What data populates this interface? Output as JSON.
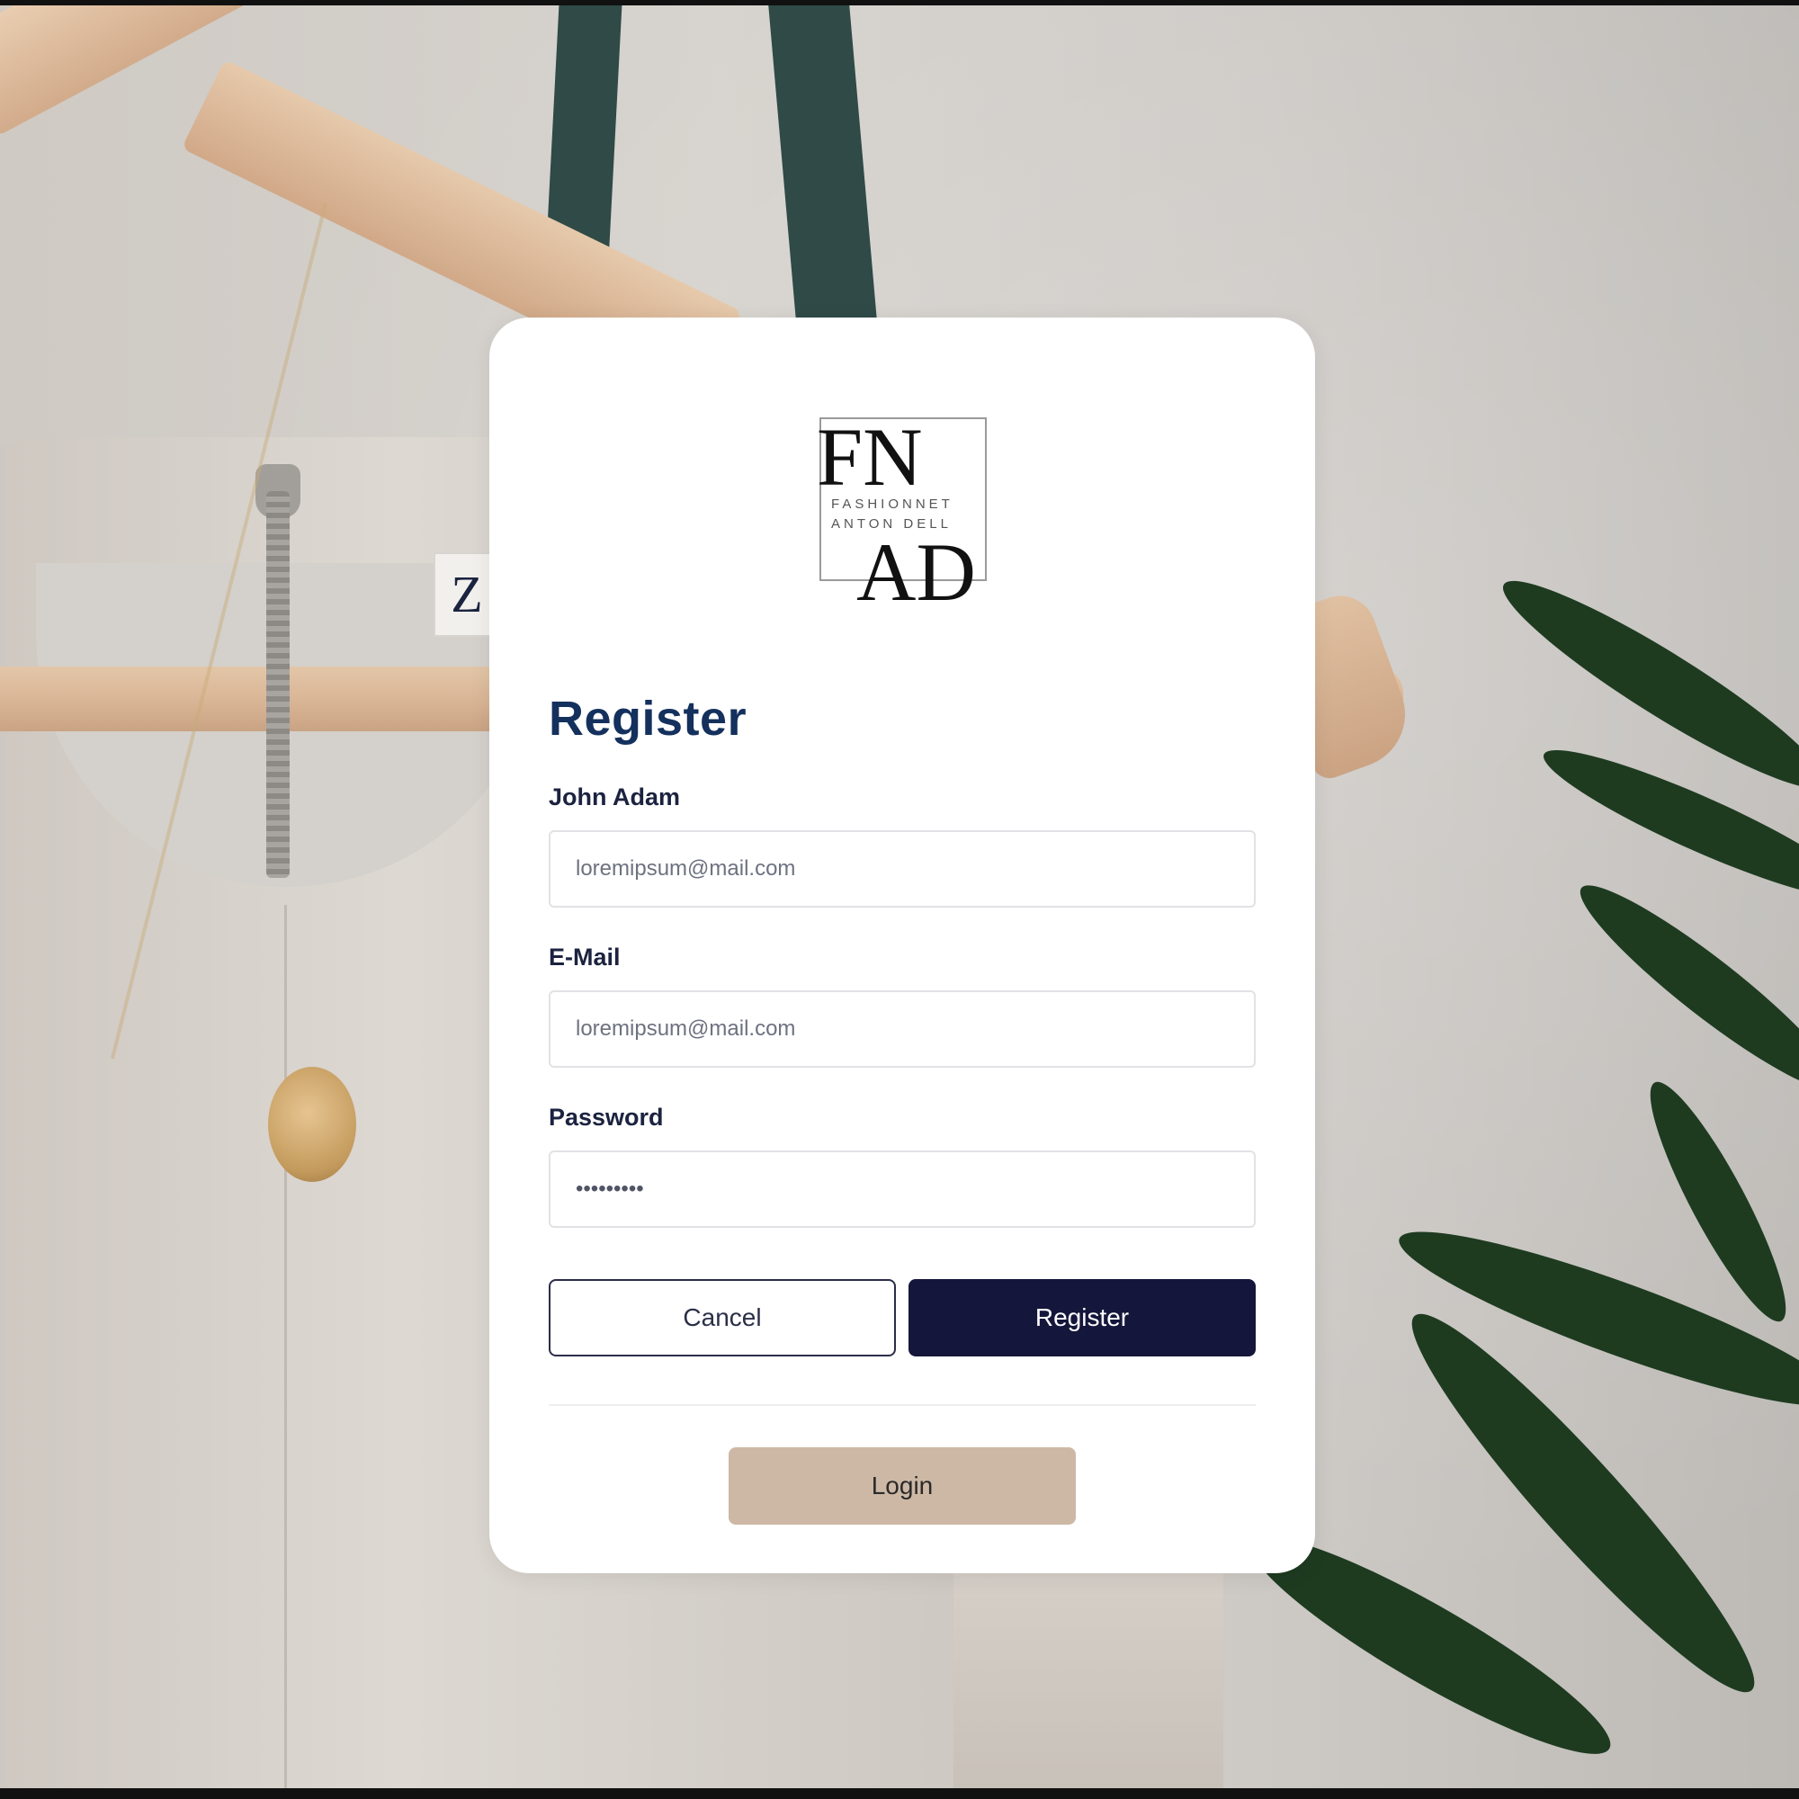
{
  "brand": {
    "logo_letters_top": "FN",
    "logo_letters_bottom": "AD",
    "logo_line_1": "FASHIONNET",
    "logo_line_2": "ANTON DELL"
  },
  "form": {
    "title": "Register",
    "fields": [
      {
        "label": "John Adam",
        "placeholder": "loremipsum@mail.com",
        "type": "text"
      },
      {
        "label": "E-Mail",
        "placeholder": "loremipsum@mail.com",
        "type": "email"
      },
      {
        "label": "Password",
        "value": "•••••••••",
        "type": "password"
      }
    ],
    "cancel_label": "Cancel",
    "register_label": "Register",
    "login_label": "Login"
  },
  "colors": {
    "heading": "#14305d",
    "primary_button": "#15163b",
    "login_button": "#cdb8a5",
    "card": "#ffffff"
  }
}
